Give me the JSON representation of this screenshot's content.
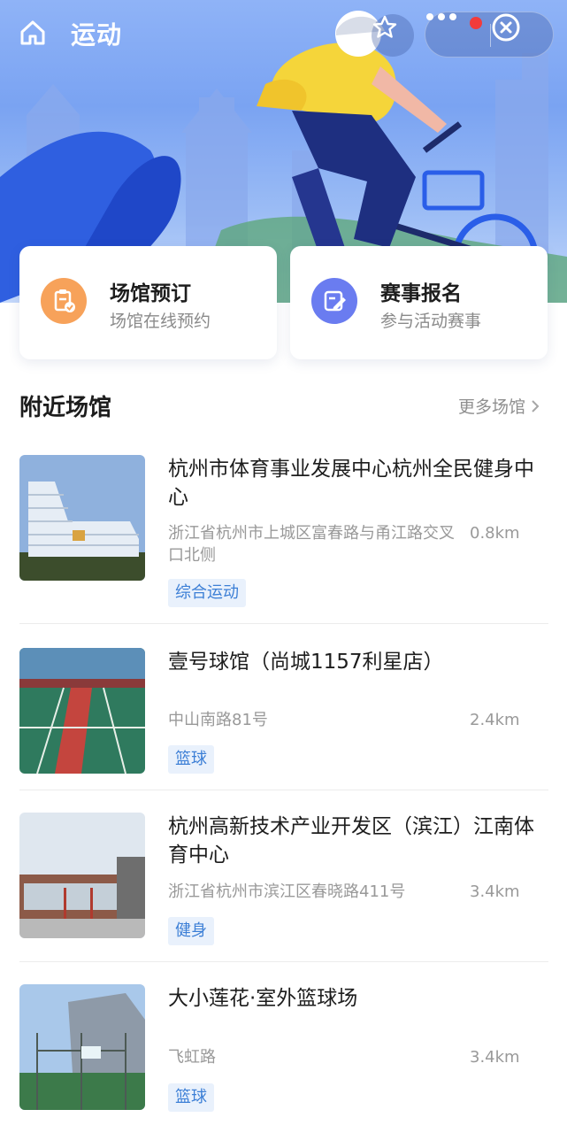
{
  "header": {
    "title": "运动"
  },
  "icons": {
    "home": "home-icon",
    "favorite": "star-icon",
    "more": "more-dots-icon",
    "close": "close-circle-icon"
  },
  "services": [
    {
      "title": "场馆预订",
      "subtitle": "场馆在线预约",
      "icon": "clipboard-check-icon",
      "color": "#f7a25a"
    },
    {
      "title": "赛事报名",
      "subtitle": "参与活动赛事",
      "icon": "edit-form-icon",
      "color": "#6a7cf0"
    }
  ],
  "nearby": {
    "title": "附近场馆",
    "more_label": "更多场馆",
    "venues": [
      {
        "name": "杭州市体育事业发展中心杭州全民健身中心",
        "address": "浙江省杭州市上城区富春路与甬江路交叉口北侧",
        "distance": "0.8km",
        "tag": "综合运动"
      },
      {
        "name": "壹号球馆（尚城1157利星店）",
        "address": "中山南路81号",
        "distance": "2.4km",
        "tag": "篮球"
      },
      {
        "name": "杭州高新技术产业开发区（滨江）江南体育中心",
        "address": "浙江省杭州市滨江区春晓路411号",
        "distance": "3.4km",
        "tag": "健身"
      },
      {
        "name": "大小莲花·室外篮球场",
        "address": "飞虹路",
        "distance": "3.4km",
        "tag": "篮球"
      }
    ]
  },
  "colors": {
    "accent": "#3c7fd6",
    "tag_bg": "#e9f1fc",
    "notice": "#f23b3b"
  }
}
